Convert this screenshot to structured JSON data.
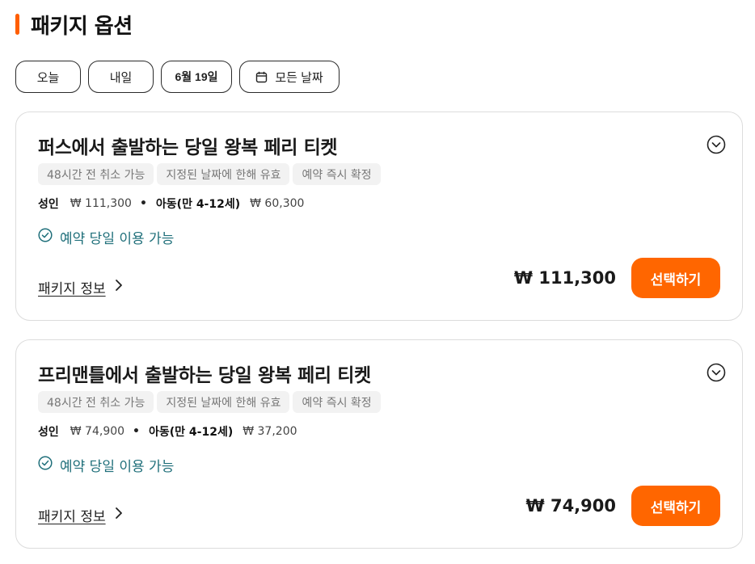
{
  "section": {
    "title": "패키지 옵션"
  },
  "date_filters": [
    {
      "label": "오늘"
    },
    {
      "label": "내일"
    },
    {
      "label": "6월 19일"
    },
    {
      "label": "모든 날짜",
      "icon": "calendar-icon"
    }
  ],
  "packages": [
    {
      "title": "퍼스에서 출발하는 당일 왕복 페리 티켓",
      "tags": [
        "48시간 전 취소 가능",
        "지정된 날짜에 한해 유효",
        "예약 즉시 확정"
      ],
      "adult_label": "성인",
      "adult_price": "₩ 111,300",
      "child_label": "아동(만 4-12세)",
      "child_price": "₩ 60,300",
      "availability": "예약 당일 이용 가능",
      "info_link": "패키지 정보",
      "total_price": "₩ 111,300",
      "select_label": "선택하기"
    },
    {
      "title": "프리맨틀에서 출발하는 당일 왕복 페리 티켓",
      "tags": [
        "48시간 전 취소 가능",
        "지정된 날짜에 한해 유효",
        "예약 즉시 확정"
      ],
      "adult_label": "성인",
      "adult_price": "₩ 74,900",
      "child_label": "아동(만 4-12세)",
      "child_price": "₩ 37,200",
      "availability": "예약 당일 이용 가능",
      "info_link": "패키지 정보",
      "total_price": "₩ 74,900",
      "select_label": "선택하기"
    }
  ],
  "colors": {
    "accent": "#ff6600",
    "availability": "#1f6f7a",
    "tag_bg": "#f2f2f2"
  }
}
